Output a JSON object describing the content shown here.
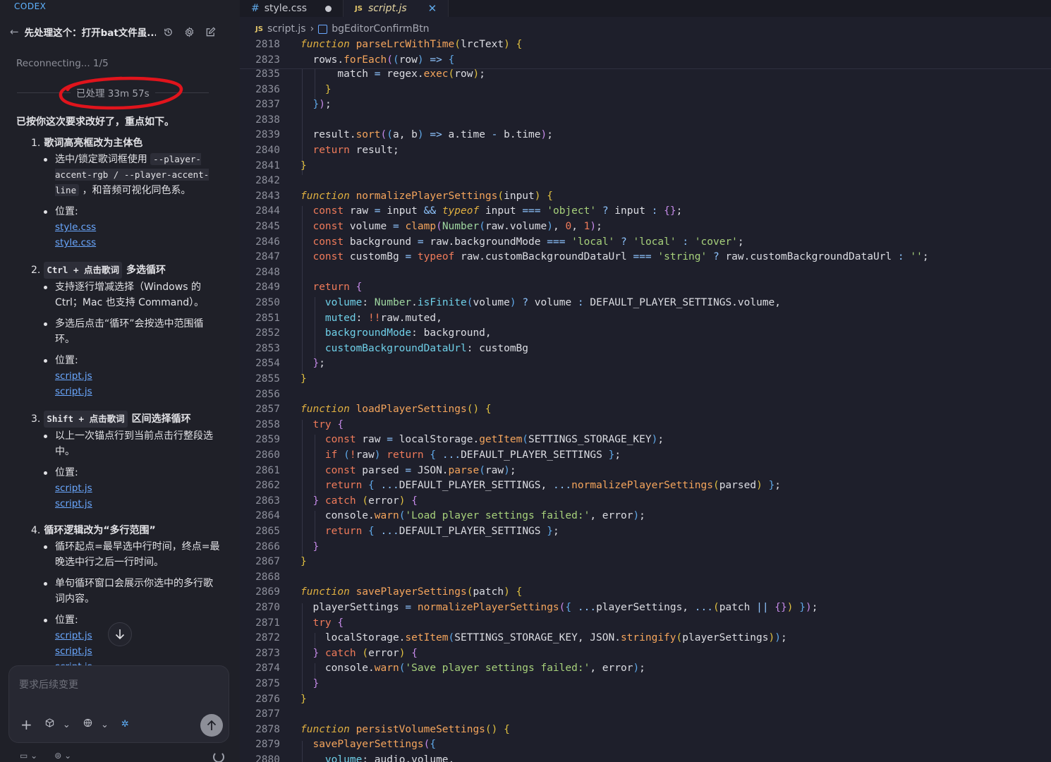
{
  "sidebar": {
    "brand": "CODEX",
    "thread_title": "先处理这个：打开bat文件虽...",
    "reconnect": "Reconnecting... 1/5",
    "processed": "已处理 33m 57s",
    "intro": "已按你这次要求改好了，重点如下。",
    "item1": {
      "num": "1.",
      "title": "歌词高亮框改为主体色",
      "b1_pre": "选中/锁定歌词框使用",
      "b1_code": "--player-accent-rgb / --player-accent-line",
      "b1_post": "，和音频可视化同色系。",
      "b2": "位置:",
      "links": [
        "style.css",
        "style.css"
      ]
    },
    "item2": {
      "num": "2.",
      "code": "Ctrl + 点击歌词",
      "title": "多选循环",
      "b1": "支持逐行增减选择（Windows 的 Ctrl；Mac 也支持 Command）。",
      "b2": "多选后点击“循环”会按选中范围循环。",
      "b3": "位置:",
      "links": [
        "script.js",
        "script.js"
      ]
    },
    "item3": {
      "num": "3.",
      "code": "Shift + 点击歌词",
      "title": "区间选择循环",
      "b1": "以上一次锚点行到当前点击行整段选中。",
      "b2": "位置:",
      "links": [
        "script.js",
        "script.js"
      ]
    },
    "item4": {
      "num": "4.",
      "title": "循环逻辑改为“多行范围”",
      "b1": "循环起点=最早选中行时间，终点=最晚选中行之后一行时间。",
      "b2": "单句循环窗口会展示你选中的多行歌词内容。",
      "b3": "位置:",
      "links": [
        "script.js",
        "script.js",
        "script.js"
      ]
    },
    "composer_placeholder": "要求后续变更",
    "colors": {
      "accent_link": "#6aa8ff",
      "annotation_circle": "#e0141c"
    }
  },
  "editor": {
    "tabs": [
      {
        "label": "style.css",
        "icon": "#",
        "modified": true
      },
      {
        "label": "script.js",
        "icon": "JS",
        "active": true
      }
    ],
    "breadcrumb": {
      "file": "script.js",
      "symbol": "bgEditorConfirmBtn"
    }
  }
}
